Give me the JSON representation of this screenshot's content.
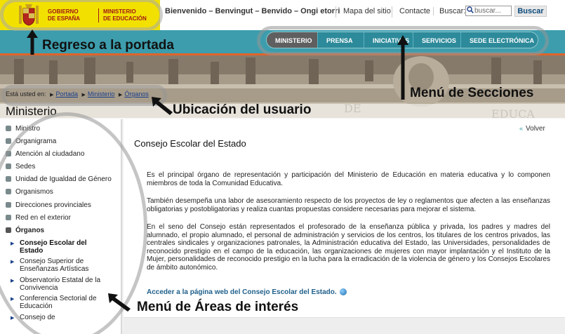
{
  "header": {
    "logo": {
      "line1": "GOBIERNO",
      "line2": "DE ESPAÑA",
      "line3": "MINISTERIO",
      "line4": "DE EDUCACIÓN"
    },
    "welcome": "Bienvenido – Benvingut – Benvido – Ongi etorri",
    "links": {
      "map": "Mapa del sitio",
      "contact": "Contacte"
    },
    "search": {
      "label": "Buscar:",
      "placeholder": "buscar...",
      "button": "Buscar"
    }
  },
  "nav": {
    "items": [
      {
        "label": "MINISTERIO",
        "active": true
      },
      {
        "label": "PRENSA",
        "active": false
      },
      {
        "label": "INICIATIVAS",
        "active": false
      },
      {
        "label": "SERVICIOS",
        "active": false
      },
      {
        "label": "SEDE ELECTRÓNICA",
        "active": false
      }
    ]
  },
  "breadcrumb": {
    "prefix": "Está usted en:",
    "items": [
      "Portada",
      "Ministerio",
      "Órganos"
    ]
  },
  "section_title": "Ministerio",
  "sidebar": {
    "items": [
      {
        "label": "Ministro"
      },
      {
        "label": "Organigrama"
      },
      {
        "label": "Atención al ciudadano"
      },
      {
        "label": "Sedes"
      },
      {
        "label": "Unidad de Igualdad de Género"
      },
      {
        "label": "Organismos"
      },
      {
        "label": "Direcciones provinciales"
      },
      {
        "label": "Red en el exterior"
      },
      {
        "label": "Órganos",
        "expanded": true
      }
    ],
    "subitems": [
      {
        "label": "Consejo Escolar del Estado",
        "active": true
      },
      {
        "label": "Consejo Superior de Enseñanzas Artísticas"
      },
      {
        "label": "Observatorio Estatal de la Convivencia"
      },
      {
        "label": "Conferencia Sectorial de Educación"
      },
      {
        "label": "Consejo de"
      }
    ]
  },
  "main": {
    "back": "Volver",
    "title": "Consejo Escolar del Estado",
    "paragraphs": [
      "Es el principal órgano de representación y participación del Ministerio de Educación en materia educativa y lo componen miembros de toda la Comunidad Educativa.",
      "También desempeña una labor de asesoramiento respecto de los proyectos de ley o reglamentos que afecten a las enseñanzas obligatorias y postobligatorias y realiza cuantas propuestas considere necesarias para mejorar el sistema.",
      "En el seno del Consejo están representados el profesorado de la enseñanza pública y privada, los padres y madres del alumnado, el propio alumnado, el personal de administración y servicios de los centros, los titulares de los centros privados, las centrales sindicales y organizaciones patronales, la Administración educativa del Estado, las Universidades, personalidades de reconocido prestigio en el campo de la educación, las organizaciones de mujeres con mayor implantación y el Instituto de la Mujer, personalidades de reconocido prestigio en la lucha para la erradicación de la violencia de género y los Consejos Escolares de ámbito autonómico."
    ],
    "external_link": "Acceder a la página web del Consejo Escolar del Estado."
  },
  "annotations": {
    "portada": "Regreso a la portada",
    "secciones": "Menú de Secciones",
    "ubicacion": "Ubicación del usuario",
    "areas": "Menú de Áreas de interés"
  },
  "colors": {
    "logo_yellow": "#f2e100",
    "band_teal": "#3d9dad",
    "nav_active": "#5f5f5f",
    "accent_orange": "#e0642a",
    "link_blue": "#1b3f8b"
  }
}
